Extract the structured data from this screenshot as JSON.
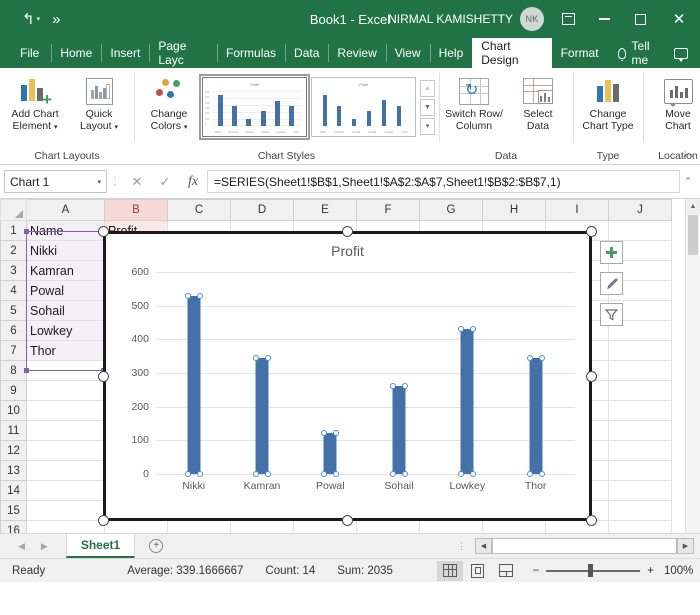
{
  "titlebar": {
    "undo_icon": "undo-icon",
    "redo_more_icon": "more-commands-icon",
    "document_title": "Book1  -  Excel",
    "user_name": "NIRMAL KAMISHETTY",
    "user_initials": "NK",
    "ribbon_display_options": "ribbon-display-options-icon",
    "minimize": "minimize-icon",
    "maximize": "maximize-icon",
    "close": "close-icon"
  },
  "tabs": [
    {
      "label": "File",
      "active": false
    },
    {
      "label": "Home",
      "active": false
    },
    {
      "label": "Insert",
      "active": false
    },
    {
      "label": "Page Layc",
      "active": false
    },
    {
      "label": "Formulas",
      "active": false
    },
    {
      "label": "Data",
      "active": false
    },
    {
      "label": "Review",
      "active": false
    },
    {
      "label": "View",
      "active": false
    },
    {
      "label": "Help",
      "active": false
    },
    {
      "label": "Chart Design",
      "active": true
    },
    {
      "label": "Format",
      "active": false
    }
  ],
  "tellme": {
    "label": "Tell me",
    "icon": "lightbulb-icon"
  },
  "comment_icon": "comment-icon",
  "ribbon": {
    "groups": [
      {
        "name": "Chart Layouts",
        "label": "Chart Layouts",
        "buttons": [
          {
            "label_line1": "Add Chart",
            "label_line2": "Element",
            "icon": "add-chart-element-icon",
            "dropdown": true
          },
          {
            "label_line1": "Quick",
            "label_line2": "Layout",
            "icon": "quick-layout-icon",
            "dropdown": true
          }
        ]
      },
      {
        "name": "Chart Styles",
        "label": "Chart Styles",
        "buttons": [
          {
            "label_line1": "Change",
            "label_line2": "Colors",
            "icon": "change-colors-icon",
            "dropdown": true
          }
        ],
        "gallery": {
          "thumb_title": "Profit",
          "items": [
            {
              "name": "chart-style-1",
              "selected": true
            },
            {
              "name": "chart-style-2",
              "selected": false
            }
          ],
          "scroll_up": "scroll-up-icon",
          "scroll_down": "scroll-down-icon",
          "more": "more-styles-icon"
        }
      },
      {
        "name": "Data",
        "label": "Data",
        "buttons": [
          {
            "label_line1": "Switch Row/",
            "label_line2": "Column",
            "icon": "switch-row-column-icon",
            "dropdown": false
          },
          {
            "label_line1": "Select",
            "label_line2": "Data",
            "icon": "select-data-icon",
            "dropdown": false
          }
        ]
      },
      {
        "name": "Type",
        "label": "Type",
        "buttons": [
          {
            "label_line1": "Change",
            "label_line2": "Chart Type",
            "icon": "change-chart-type-icon",
            "dropdown": false
          }
        ]
      },
      {
        "name": "Location",
        "label": "Location",
        "buttons": [
          {
            "label_line1": "Move",
            "label_line2": "Chart",
            "icon": "move-chart-icon",
            "dropdown": false
          }
        ]
      }
    ],
    "collapse_icon": "collapse-ribbon-icon"
  },
  "formulabar": {
    "namebox_value": "Chart 1",
    "namebox_caret": "chevron-down-icon",
    "cancel_icon": "cancel-icon",
    "enter_icon": "enter-icon",
    "fx_icon": "insert-function-icon",
    "formula": "=SERIES(Sheet1!$B$1,Sheet1!$A$2:$A$7,Sheet1!$B$2:$B$7,1)",
    "expand_icon": "expand-formula-bar-icon"
  },
  "grid": {
    "columns": [
      "A",
      "B",
      "C",
      "D",
      "E",
      "F",
      "G",
      "H",
      "I",
      "J"
    ],
    "highlighted_column": "B",
    "rows": [
      1,
      2,
      3,
      4,
      5,
      6,
      7,
      8,
      9,
      10,
      11,
      12,
      13,
      14,
      15,
      16
    ],
    "cells": {
      "A1": "Name",
      "B1": "Profit",
      "A2": "Nikki",
      "A3": "Kamran",
      "A4": "Powal",
      "A5": "Sohail",
      "A6": "Lowkey",
      "A7": "Thor"
    }
  },
  "chart": {
    "title": "Profit",
    "elements_button": "chart-elements-icon",
    "styles_button": "chart-styles-icon",
    "filters_button": "chart-filters-icon",
    "annotation_arrow": "pointer-arrow-annotation"
  },
  "chart_data": {
    "type": "bar",
    "title": "Profit",
    "categories": [
      "Nikki",
      "Kamran",
      "Powal",
      "Sohail",
      "Lowkey",
      "Thor"
    ],
    "values": [
      530,
      345,
      122,
      262,
      432,
      344
    ],
    "series": [
      {
        "name": "Profit",
        "values": [
          530,
          345,
          122,
          262,
          432,
          344
        ],
        "color": "#4472a8"
      }
    ],
    "xlabel": "",
    "ylabel": "",
    "ylim": [
      0,
      600
    ],
    "yticks": [
      0,
      100,
      200,
      300,
      400,
      500,
      600
    ],
    "grid": true,
    "legend": "none",
    "selected": true
  },
  "sheettabs": {
    "prev_icon": "previous-sheet-icon",
    "next_icon": "next-sheet-icon",
    "sheets": [
      {
        "label": "Sheet1",
        "active": true
      }
    ],
    "add_sheet_icon": "add-sheet-icon",
    "hscroll_left": "scroll-left-icon",
    "hscroll_right": "scroll-right-icon"
  },
  "statusbar": {
    "mode": "Ready",
    "average": "Average: 339.1666667",
    "count": "Count: 14",
    "sum": "Sum: 2035",
    "views": [
      {
        "name": "normal-view",
        "icon": "normal-view-icon",
        "active": true
      },
      {
        "name": "page-layout-view",
        "icon": "page-layout-icon",
        "active": false
      },
      {
        "name": "page-break-view",
        "icon": "page-break-icon",
        "active": false
      }
    ],
    "zoom_out": "zoom-out-icon",
    "zoom_in": "zoom-in-icon",
    "zoom_level": "100%"
  }
}
